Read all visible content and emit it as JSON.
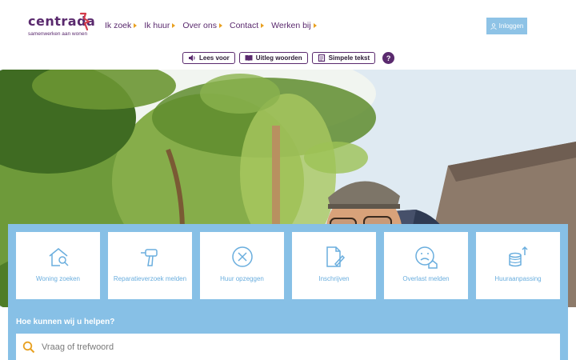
{
  "brand": {
    "name": "centrada",
    "tagline": "samenwerken aan wonen"
  },
  "nav": {
    "items": [
      {
        "label": "Ik zoek"
      },
      {
        "label": "Ik huur"
      },
      {
        "label": "Over ons"
      },
      {
        "label": "Contact"
      },
      {
        "label": "Werken bij"
      }
    ]
  },
  "login": {
    "label": "Inloggen"
  },
  "accessibility": {
    "read_aloud": "Lees voor",
    "explain_words": "Uitleg woorden",
    "simple_text": "Simpele tekst",
    "help": "?"
  },
  "services": {
    "tiles": [
      {
        "label": "Woning zoeken",
        "icon": "house-search-icon"
      },
      {
        "label": "Reparatieverzoek melden",
        "icon": "drill-icon"
      },
      {
        "label": "Huur opzeggen",
        "icon": "close-circle-icon"
      },
      {
        "label": "Inschrijven",
        "icon": "document-pen-icon"
      },
      {
        "label": "Overlast melden",
        "icon": "sad-face-house-icon"
      },
      {
        "label": "Huuraanpassing",
        "icon": "coins-arrows-icon"
      }
    ]
  },
  "help": {
    "title": "Hoe kunnen wij u helpen?",
    "search_placeholder": "Vraag of trefwoord"
  },
  "colors": {
    "brand_purple": "#5a2a6e",
    "panel_blue": "#87c0e6",
    "accent_orange": "#e8a020",
    "tile_text": "#6aaede"
  }
}
